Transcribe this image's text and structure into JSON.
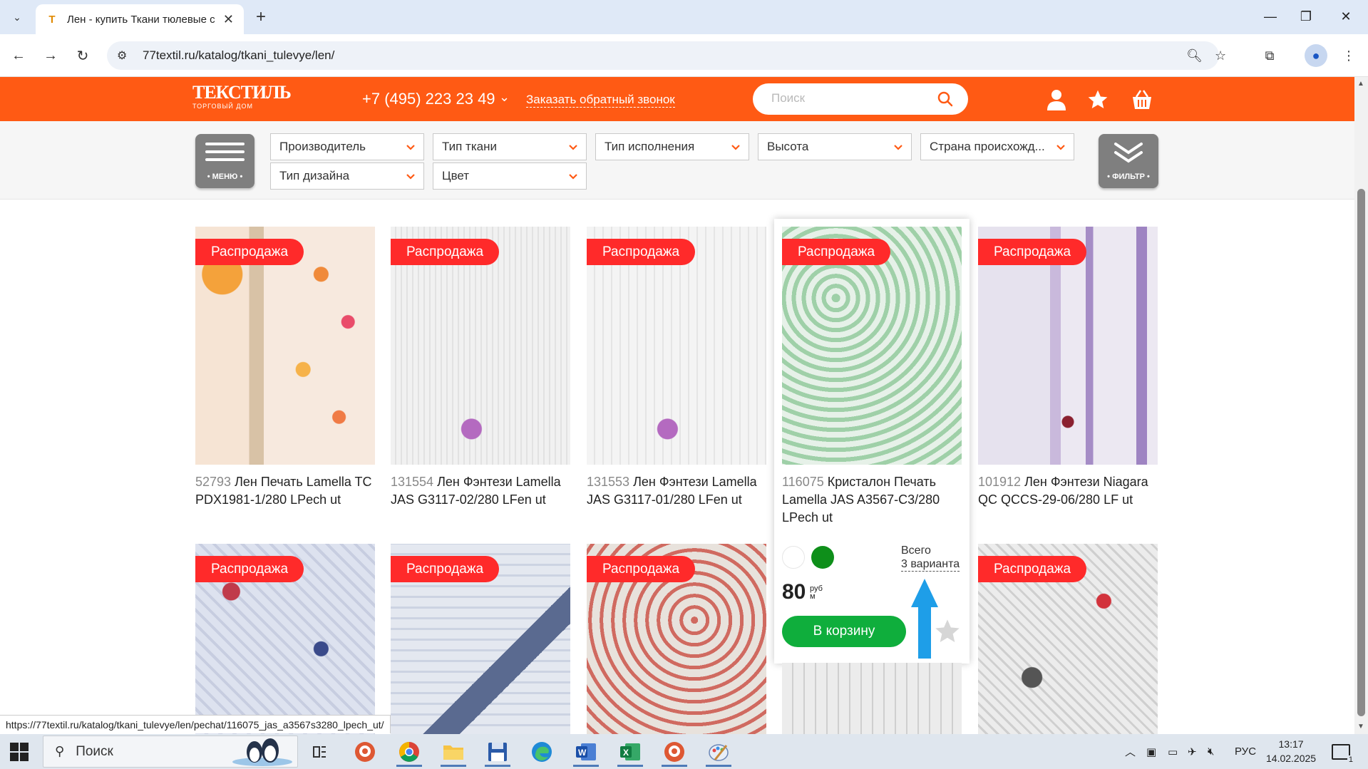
{
  "browser": {
    "tab_title": "Лен - купить Ткани тюлевые с",
    "url": "77textil.ru/katalog/tkani_tulevye/len/",
    "status_url": "https://77textil.ru/katalog/tkani_tulevye/len/pechat/116075_jas_a3567s3280_lpech_ut/"
  },
  "header": {
    "logo_text": "ТЕКСТИЛЬ",
    "logo_sub": "ТОРГОВЫЙ ДОМ",
    "phone": "+7 (495) 223 23 49",
    "callback": "Заказать обратный звонок",
    "search_placeholder": "Поиск"
  },
  "filters": {
    "menu_label": "• МЕНЮ •",
    "filter_label": "• ФИЛЬТР •",
    "dropdowns": [
      "Производитель",
      "Тип ткани",
      "Тип исполнения",
      "Высота",
      "Страна происхожд...",
      "Тип дизайна",
      "Цвет"
    ]
  },
  "products": [
    {
      "badge": "Распродажа",
      "code": "52793",
      "name": "Лен Печать Lamella TC PDX1981-1/280 LPech ut"
    },
    {
      "badge": "Распродажа",
      "code": "131554",
      "name": "Лен Фэнтези Lamella JAS G3117-02/280 LFen ut"
    },
    {
      "badge": "Распродажа",
      "code": "131553",
      "name": "Лен Фэнтези Lamella JAS G3117-01/280 LFen ut"
    },
    {
      "badge": "Распродажа",
      "code": "116075",
      "name": "Кристалон Печать Lamella JAS A3567-C3/280 LPech ut"
    },
    {
      "badge": "Распродажа",
      "code": "101912",
      "name": "Лен Фэнтези Niagara QC QCCS-29-06/280 LF ut"
    }
  ],
  "row2_badges": [
    "Распродажа",
    "Распродажа",
    "Распродажа",
    "Распродажа"
  ],
  "highlight": {
    "variants_line1": "Всего",
    "variants_line2": "3 варианта",
    "price": "80",
    "unit_top": "руб",
    "unit_bottom": "м",
    "cart_label": "В корзину"
  },
  "taskbar": {
    "search_label": "Поиск",
    "lang": "РУС",
    "time": "13:17",
    "date": "14.02.2025",
    "notif_count": "1"
  },
  "colors": {
    "brand_orange": "#ff5a14",
    "badge_red": "#ff2a2a",
    "cart_green": "#0fae3c",
    "arrow_blue": "#1e9ee8"
  }
}
